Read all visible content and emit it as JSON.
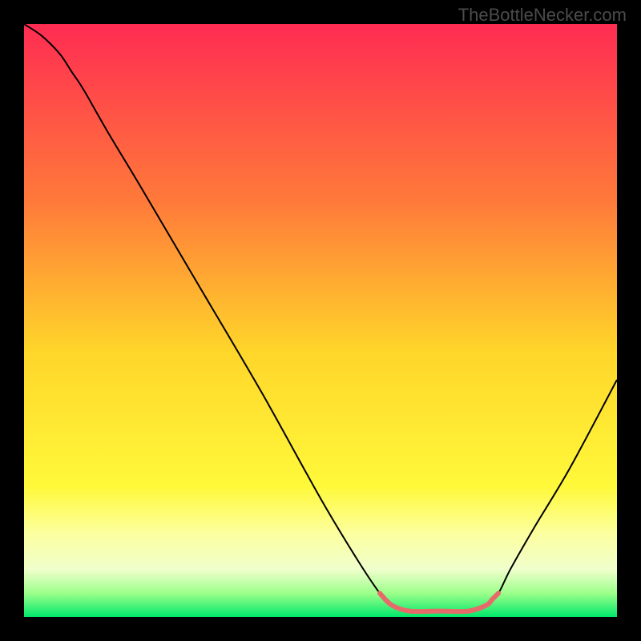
{
  "watermark": "TheBottleNecker.com",
  "chart_data": {
    "type": "line",
    "title": "",
    "xlabel": "",
    "ylabel": "",
    "xlim": [
      0,
      100
    ],
    "ylim": [
      0,
      100
    ],
    "gradient_stops": [
      {
        "offset": 0,
        "color": "#ff2c52"
      },
      {
        "offset": 0.3,
        "color": "#ff7a3a"
      },
      {
        "offset": 0.55,
        "color": "#ffd52a"
      },
      {
        "offset": 0.78,
        "color": "#fff93a"
      },
      {
        "offset": 0.86,
        "color": "#fcffa0"
      },
      {
        "offset": 0.92,
        "color": "#f0ffcc"
      },
      {
        "offset": 0.96,
        "color": "#9cff8a"
      },
      {
        "offset": 1.0,
        "color": "#00e86b"
      }
    ],
    "series": [
      {
        "name": "curve",
        "stroke": "#000000",
        "x": [
          0,
          3,
          6,
          8,
          10,
          14,
          20,
          30,
          40,
          50,
          56,
          60,
          62,
          65,
          70,
          75,
          78,
          80,
          82,
          86,
          92,
          100
        ],
        "y": [
          100,
          98,
          95,
          92,
          89,
          82,
          72,
          55,
          38,
          20,
          10,
          4,
          2,
          1,
          1,
          1,
          2,
          4,
          8,
          15,
          25,
          40
        ]
      },
      {
        "name": "optimal-band",
        "stroke": "#e76a6a",
        "stroke_width": 6,
        "x": [
          60,
          62,
          65,
          70,
          75,
          78,
          79,
          80
        ],
        "y": [
          4,
          2,
          1,
          1,
          1,
          2,
          3,
          4
        ]
      }
    ]
  }
}
